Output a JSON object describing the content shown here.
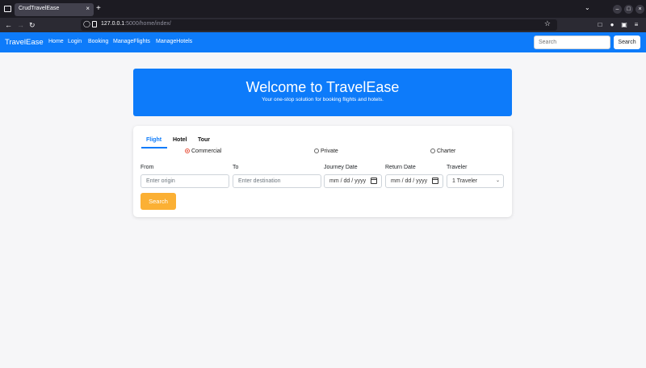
{
  "browser": {
    "tab_title": "CrudTravelEase",
    "tab_close": "×",
    "new_tab": "+",
    "url_host": "127.0.0.1",
    "url_rest": ":5000/home/index/"
  },
  "site": {
    "brand": "TravelEase",
    "nav_links": [
      "Home",
      "Login",
      "Booking",
      "ManageFlights",
      "ManageHotels"
    ],
    "search_placeholder": "Search",
    "search_button": "Search"
  },
  "hero": {
    "title": "Welcome to TravelEase",
    "subtitle": "Your one-stop solution for booking flights and hotels."
  },
  "booking": {
    "tabs": [
      "Flight",
      "Hotel",
      "Tour"
    ],
    "active_tab": "Flight",
    "trip_types": [
      "Commercial",
      "Private",
      "Charter"
    ],
    "selected_trip_type": "Commercial",
    "labels": {
      "from": "From",
      "to": "To",
      "journey_date": "Journey Date",
      "return_date": "Return Date",
      "traveler": "Traveler"
    },
    "placeholders": {
      "from": "Enter origin",
      "to": "Enter destination",
      "journey_date": "mm / dd / yyyy",
      "return_date": "mm / dd / yyyy"
    },
    "traveler_value": "1 Traveler",
    "search_button": "Search"
  },
  "colors": {
    "brand_blue": "#0d7bfa",
    "search_orange": "#fbb034",
    "radio_checked": "#e8533d"
  }
}
